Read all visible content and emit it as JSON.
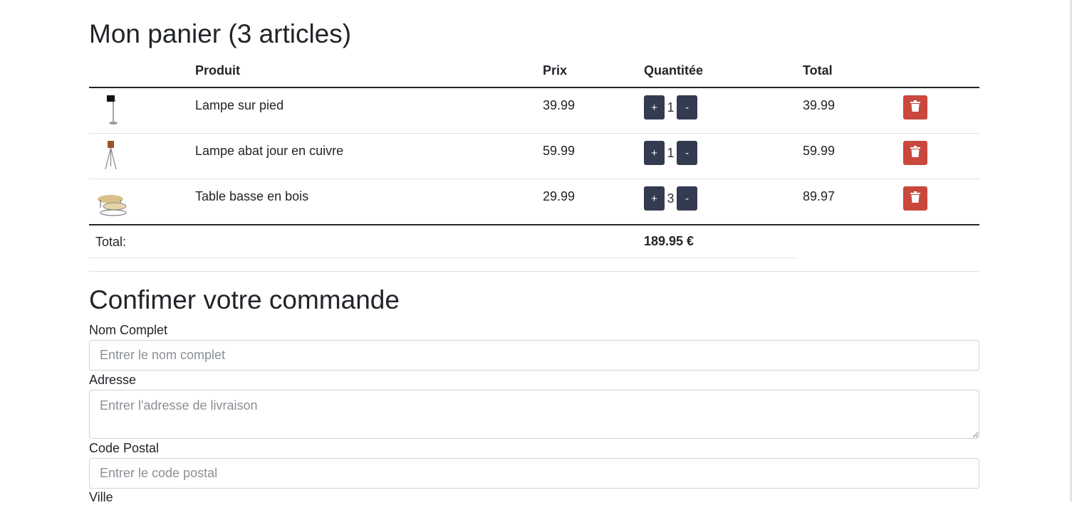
{
  "cart": {
    "title": "Mon panier (3 articles)",
    "headers": {
      "product": "Produit",
      "price": "Prix",
      "quantity": "Quantitée",
      "total": "Total"
    },
    "items": [
      {
        "image_icon": "floor-lamp-image",
        "name": "Lampe sur pied",
        "price": "39.99",
        "qty": "1",
        "total": "39.99"
      },
      {
        "image_icon": "tripod-lamp-image",
        "name": "Lampe abat jour en cuivre",
        "price": "59.99",
        "qty": "1",
        "total": "59.99"
      },
      {
        "image_icon": "coffee-table-image",
        "name": "Table basse en bois",
        "price": "29.99",
        "qty": "3",
        "total": "89.97"
      }
    ],
    "plus_label": "+",
    "minus_label": "-",
    "total_label": "Total:",
    "total_value": "189.95 €"
  },
  "order": {
    "title": "Confimer votre commande",
    "full_name": {
      "label": "Nom Complet",
      "placeholder": "Entrer le nom complet",
      "value": ""
    },
    "address": {
      "label": "Adresse",
      "placeholder": "Entrer l'adresse de livraison",
      "value": ""
    },
    "postal_code": {
      "label": "Code Postal",
      "placeholder": "Entrer le code postal",
      "value": ""
    },
    "city": {
      "label": "Ville"
    }
  },
  "colors": {
    "qty_button": "#343a50",
    "delete_button": "#c9473b",
    "text": "#212529"
  }
}
